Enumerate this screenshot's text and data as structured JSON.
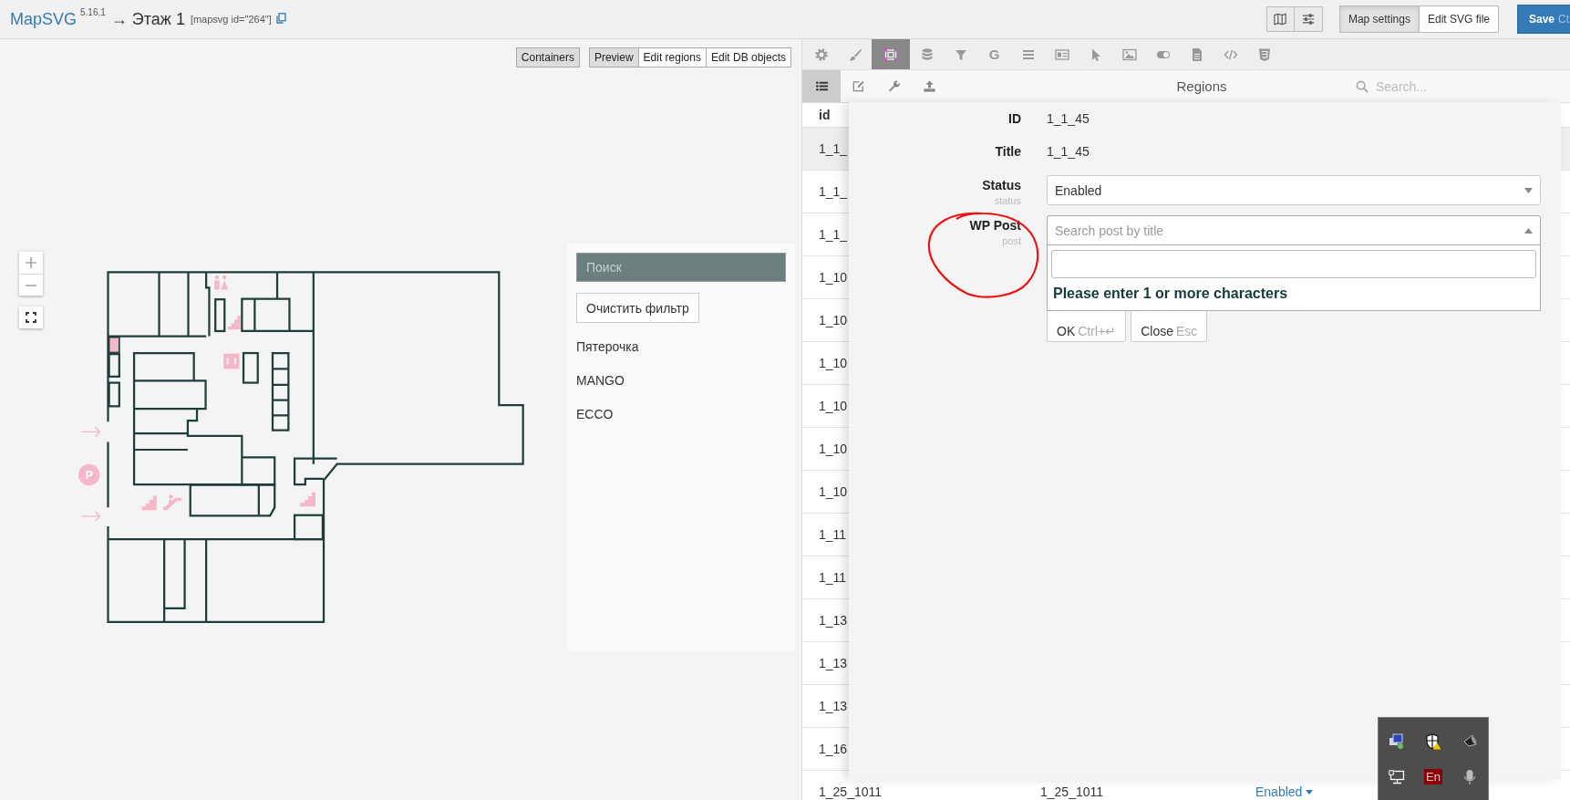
{
  "header": {
    "brand": "MapSVG",
    "version": "5.16.1",
    "title": "→ Этаж 1",
    "shortcode": "[mapsvg id=\"264\"]",
    "modes": [
      {
        "label": "Map settings",
        "selected": true
      },
      {
        "label": "Edit SVG file",
        "selected": false
      }
    ],
    "save": {
      "label": "Save",
      "shortcut": "Ct"
    }
  },
  "map": {
    "containers": {
      "label": "Containers",
      "on": true
    },
    "modes": [
      {
        "label": "Preview",
        "selected": true
      },
      {
        "label": "Edit regions",
        "selected": false
      },
      {
        "label": "Edit DB objects",
        "selected": false
      }
    ],
    "parking_label": "P",
    "directory": {
      "search_placeholder": "Поиск",
      "clear_button": "Очистить фильтр",
      "items": [
        "Пятерочка",
        "MANGO",
        "ECCO"
      ]
    }
  },
  "editor": {
    "tabs": [
      {
        "selected": false
      },
      {
        "selected": false
      },
      {
        "selected": true
      },
      {
        "selected": false
      },
      {
        "selected": false
      },
      {
        "glyph": "G",
        "selected": false
      },
      {
        "selected": false
      },
      {
        "selected": false
      },
      {
        "selected": false
      },
      {
        "selected": false
      },
      {
        "selected": false
      },
      {
        "selected": false
      },
      {
        "selected": false
      },
      {
        "selected": false
      }
    ],
    "subtabs": [
      {
        "selected": true
      },
      {
        "selected": false
      },
      {
        "selected": false
      },
      {
        "selected": false
      }
    ],
    "title": "Regions",
    "search_placeholder": "Search...",
    "table": {
      "columns": [
        "id"
      ],
      "rows": [
        {
          "cells": [
            "1_1_"
          ],
          "selected": true
        },
        {
          "cells": [
            "1_1_"
          ],
          "selected": false
        },
        {
          "cells": [
            "1_1_"
          ],
          "selected": false
        },
        {
          "cells": [
            "1_10"
          ],
          "selected": false
        },
        {
          "cells": [
            "1_10"
          ],
          "selected": false
        },
        {
          "cells": [
            "1_10"
          ],
          "selected": false
        },
        {
          "cells": [
            "1_10"
          ],
          "selected": false
        },
        {
          "cells": [
            "1_10"
          ],
          "selected": false
        },
        {
          "cells": [
            "1_10"
          ],
          "selected": false
        },
        {
          "cells": [
            "1_11"
          ],
          "selected": false
        },
        {
          "cells": [
            "1_11"
          ],
          "selected": false
        },
        {
          "cells": [
            "1_13"
          ],
          "selected": false
        },
        {
          "cells": [
            "1_13"
          ],
          "selected": false
        },
        {
          "cells": [
            "1_13"
          ],
          "selected": false
        },
        {
          "cells": [
            "1_16"
          ],
          "selected": false
        },
        {
          "cells": [
            "1_25_1011",
            "1_25_1011",
            "Enabled"
          ],
          "selected": false
        }
      ]
    },
    "form": {
      "fields": [
        {
          "kind": "text",
          "label": "ID",
          "value": "1_1_45"
        },
        {
          "kind": "text",
          "label": "Title",
          "value": "1_1_45"
        },
        {
          "kind": "select",
          "label": "Status",
          "hint": "status",
          "value": "Enabled",
          "expanded": false
        },
        {
          "kind": "select",
          "label": "WP Post",
          "hint": "post",
          "placeholder": "Search post by title",
          "expanded": true,
          "message": "Please enter 1 or more characters"
        }
      ],
      "buttons": [
        {
          "label": "OK",
          "shortcut": "Ctrl+↵"
        },
        {
          "label": "Close",
          "shortcut": "Esc"
        }
      ]
    }
  },
  "tray": {
    "language": "En"
  }
}
